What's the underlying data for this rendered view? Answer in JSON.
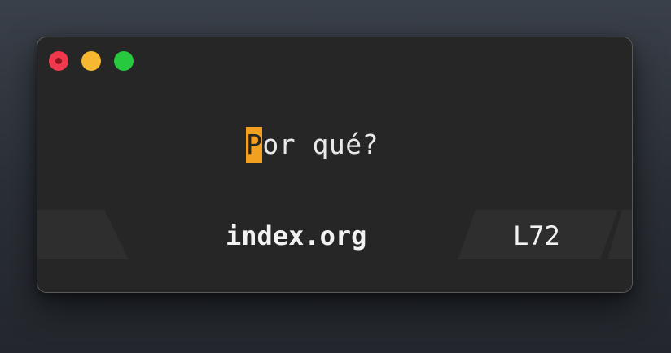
{
  "window": {
    "controls": {
      "close": "close-button",
      "minimize": "minimize-button",
      "zoom": "zoom-button"
    }
  },
  "editor": {
    "cursor_char": "P",
    "line_rest": "or qué?"
  },
  "modeline": {
    "buffer_name": "index.org",
    "line_number": "L72"
  },
  "colors": {
    "cursor": "#f1a01f",
    "close": "#f0394c",
    "minimize": "#f7b731",
    "zoom": "#27c93f"
  }
}
